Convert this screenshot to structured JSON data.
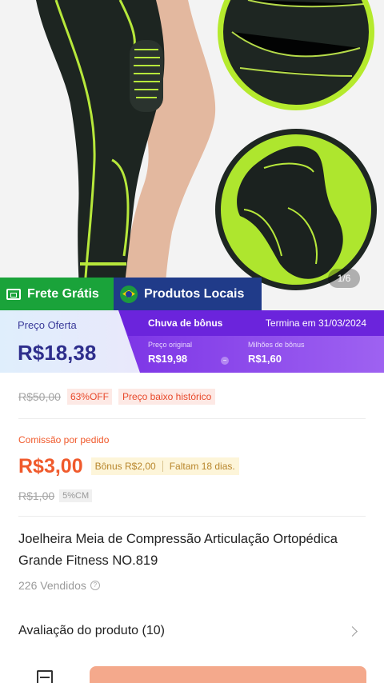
{
  "gallery": {
    "counter": "1/6",
    "images": [
      "knee-sleeve-leg-photo",
      "fabric-closeup-circle",
      "sleeve-product-circle"
    ]
  },
  "badges": {
    "frete": "Frete Grátis",
    "locais": "Produtos Locais"
  },
  "price_banner": {
    "offer_label": "Preço Oferta",
    "offer_price": "R$18,38",
    "bonus_title": "Chuva de bônus",
    "ends": "Termina em 31/03/2024",
    "original_label": "Preço original",
    "original_value": "R$19,98",
    "bonus_label": "Milhões de bônus",
    "bonus_value": "R$1,60",
    "operator": "−"
  },
  "pricing": {
    "old_price": "R$50,00",
    "discount": "63%OFF",
    "history_tag": "Preço baixo histórico"
  },
  "commission": {
    "label": "Comissão por pedido",
    "value": "R$3,00",
    "bonus_tag": "Bônus R$2,00",
    "remaining": "Faltam 18 dias.",
    "old_value": "R$1,00",
    "rate": "5%CM"
  },
  "product": {
    "title": "Joelheira Meia de Compressão Articulação Ortopédica Grande Fitness NO.819",
    "sold": "226 Vendidos"
  },
  "review": {
    "label": "Avaliação do produto (10)"
  },
  "colors": {
    "accent_orange": "#f05a2c",
    "bonus_purple": "#7d35e6",
    "frete_green": "#1aa33a",
    "locais_blue": "#203b89"
  }
}
